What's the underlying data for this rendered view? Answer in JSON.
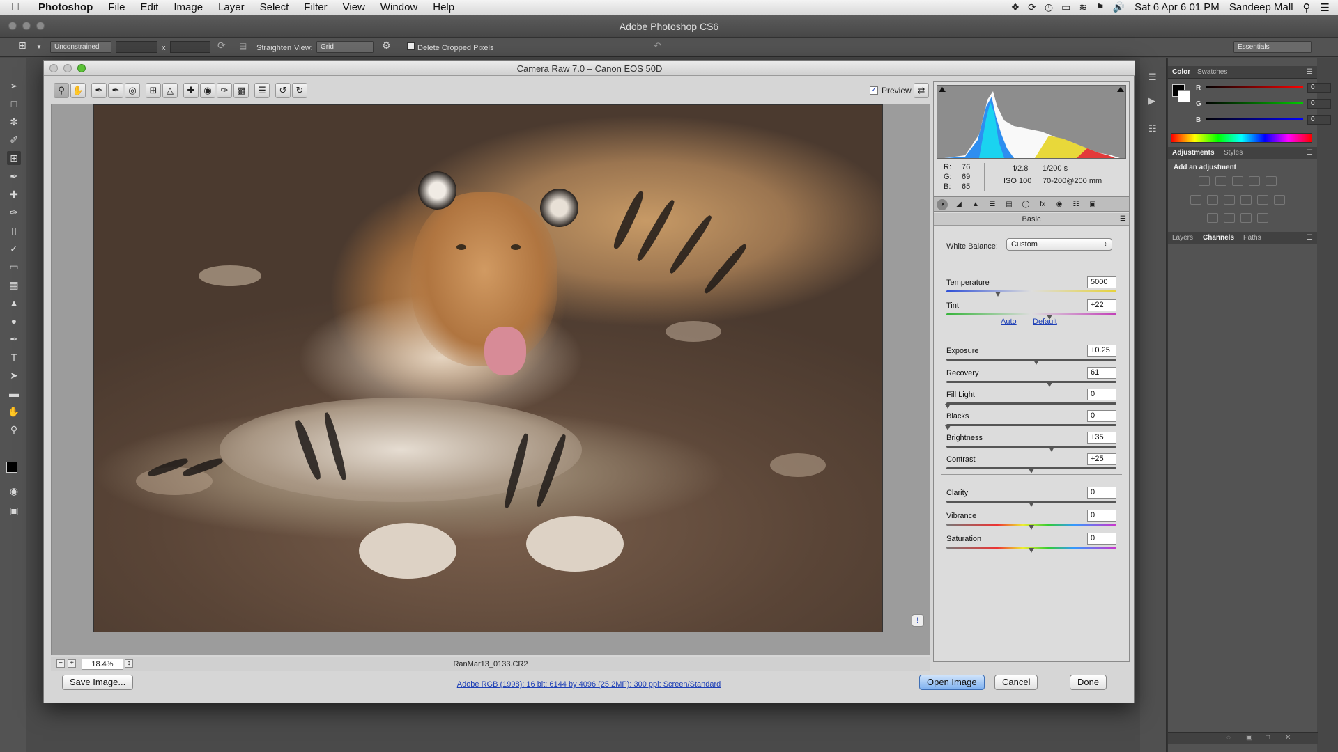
{
  "menubar": {
    "app": "Photoshop",
    "items": [
      "File",
      "Edit",
      "Image",
      "Layer",
      "Select",
      "Filter",
      "View",
      "Window",
      "Help"
    ],
    "date_time": "Sat 6 Apr  6 01 PM",
    "user": "Sandeep Mall"
  },
  "ps_window": {
    "title": "Adobe Photoshop CS6"
  },
  "options_bar": {
    "ratio": "Unconstrained",
    "x_sep": "x",
    "straighten_label": "Straighten",
    "view_label": "View:",
    "view_value": "Grid",
    "delete_cropped": "Delete Cropped Pixels",
    "workspace": "Essentials"
  },
  "panels": {
    "color_tabs": [
      "Color",
      "Swatches"
    ],
    "rgb_labels": [
      "R",
      "G",
      "B"
    ],
    "rgb_values": [
      "0",
      "0",
      "0"
    ],
    "adjust_tabs": [
      "Adjustments",
      "Styles"
    ],
    "add_adjustment": "Add an adjustment",
    "layer_tabs": [
      "Layers",
      "Channels",
      "Paths"
    ]
  },
  "dialog": {
    "title": "Camera Raw 7.0  –  Canon EOS 50D",
    "preview_label": "Preview",
    "zoom": "18.4%",
    "filename": "RanMar13_0133.CR2",
    "readout": {
      "r_label": "R:",
      "r": "76",
      "g_label": "G:",
      "g": "69",
      "b_label": "B:",
      "b": "65",
      "aperture": "f/2.8",
      "shutter": "1/200 s",
      "iso": "ISO 100",
      "lens": "70-200@200 mm"
    },
    "panel_title": "Basic",
    "white_balance_label": "White Balance:",
    "white_balance": "Custom",
    "auto_link": "Auto",
    "default_link": "Default",
    "sliders": [
      {
        "label": "Temperature",
        "value": "5000",
        "pos": 0.3
      },
      {
        "label": "Tint",
        "value": "+22",
        "pos": 0.61
      },
      {
        "label": "Exposure",
        "value": "+0.25",
        "pos": 0.53
      },
      {
        "label": "Recovery",
        "value": "61",
        "pos": 0.61
      },
      {
        "label": "Fill Light",
        "value": "0",
        "pos": 0.0
      },
      {
        "label": "Blacks",
        "value": "0",
        "pos": 0.0
      },
      {
        "label": "Brightness",
        "value": "+35",
        "pos": 0.62
      },
      {
        "label": "Contrast",
        "value": "+25",
        "pos": 0.5
      },
      {
        "label": "Clarity",
        "value": "0",
        "pos": 0.5
      },
      {
        "label": "Vibrance",
        "value": "0",
        "pos": 0.5
      },
      {
        "label": "Saturation",
        "value": "0",
        "pos": 0.5
      }
    ],
    "save_button": "Save Image...",
    "workflow": "Adobe RGB (1998); 16 bit; 6144 by 4096 (25.2MP); 300 ppi; Screen/Standard",
    "open_button": "Open Image",
    "cancel_button": "Cancel",
    "done_button": "Done"
  }
}
